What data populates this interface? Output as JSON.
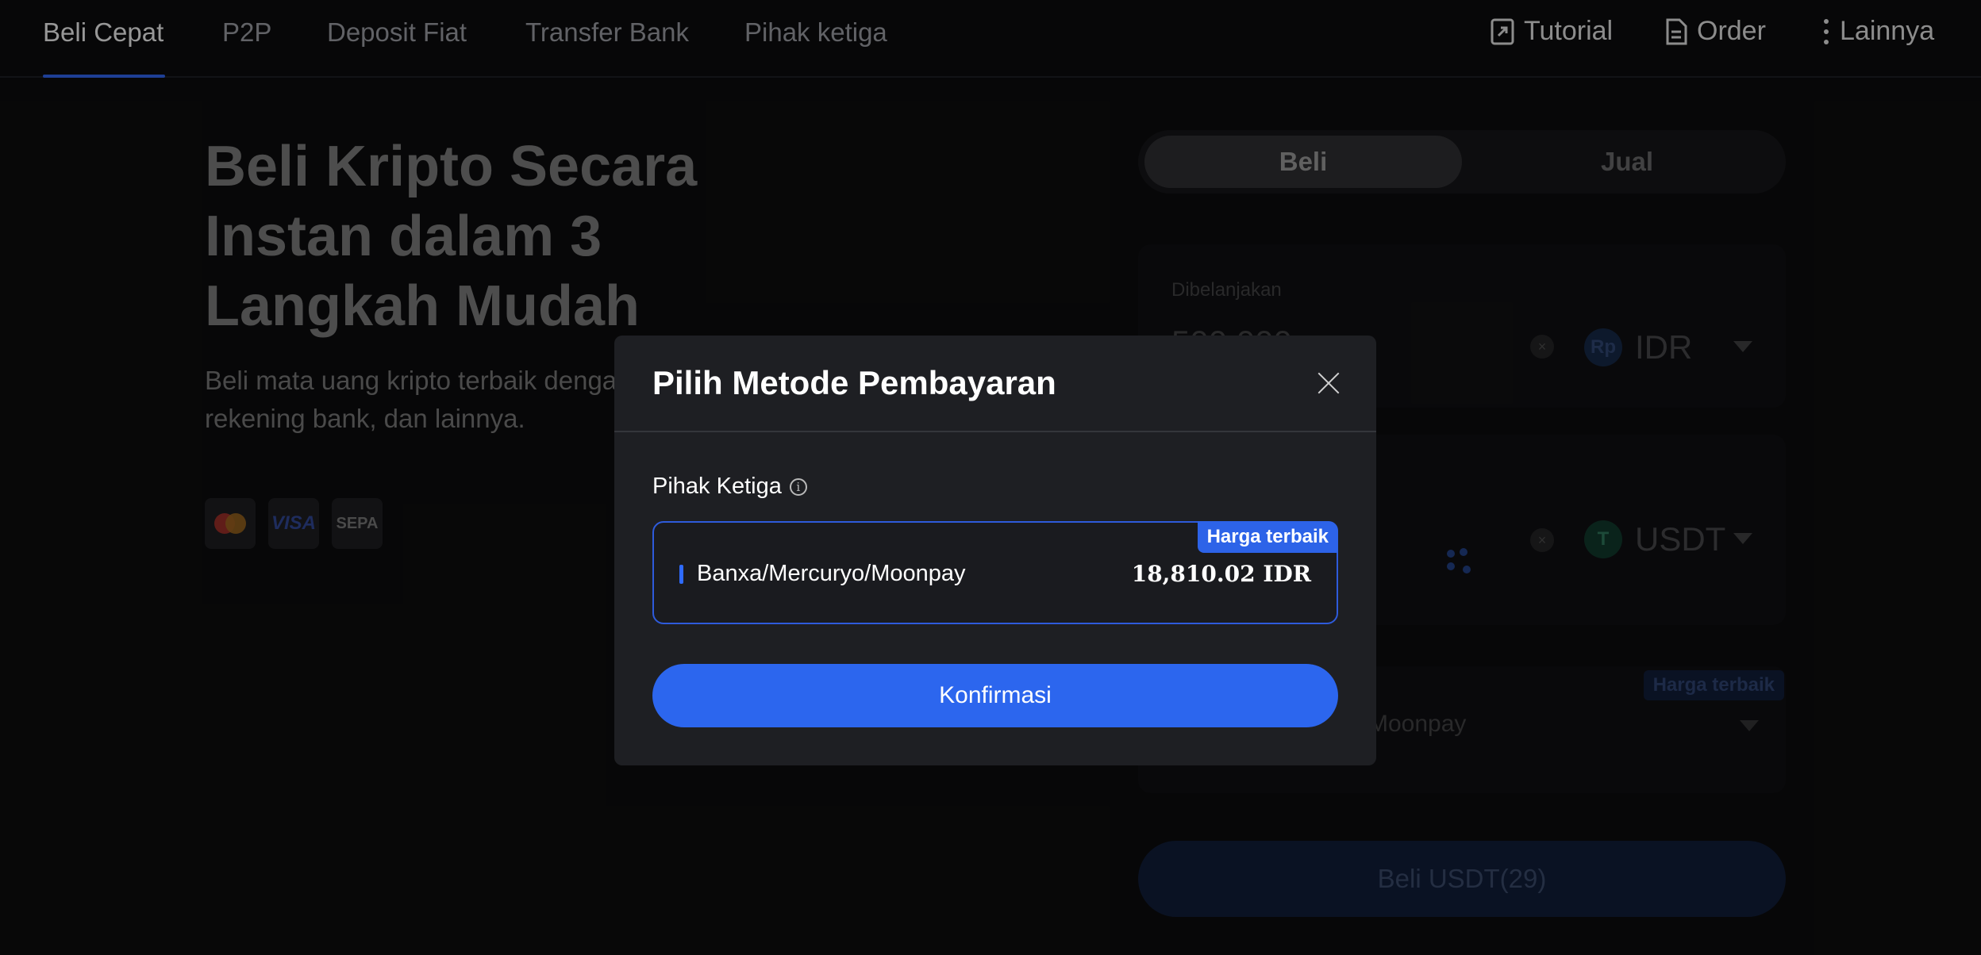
{
  "nav": {
    "tabs": [
      "Beli Cepat",
      "P2P",
      "Deposit Fiat",
      "Transfer Bank",
      "Pihak ketiga"
    ],
    "tutorial": "Tutorial",
    "order": "Order",
    "more": "Lainnya"
  },
  "hero": {
    "title": "Beli Kripto Secara Instan dalam 3 Langkah Mudah",
    "subtitle": "Beli mata uang kripto terbaik dengan rekening bank, dan lainnya.",
    "payment_icons": [
      "mastercard-icon",
      "visa-icon",
      "sepa-icon"
    ],
    "visa": "VISA",
    "sepa": "SEPA"
  },
  "trade": {
    "buy": "Beli",
    "sell": "Jual",
    "spend_label": "Dibelanjakan",
    "spend_amount": "500.000",
    "fiat_symbol": "Rp",
    "fiat": "IDR",
    "crypto_symbol": "T",
    "crypto": "USDT",
    "provider_partial": "Moonpay",
    "best_price": "Harga terbaik",
    "buy_button": "Beli USDT(29)"
  },
  "modal": {
    "title": "Pilih Metode Pembayaran",
    "section": "Pihak Ketiga",
    "info_glyph": "i",
    "option": {
      "badge": "Harga terbaik",
      "name": "Banxa/Mercuryo/Moonpay",
      "price": "18,810.02 IDR"
    },
    "confirm": "Konfirmasi"
  },
  "colors": {
    "accent": "#2c66ee",
    "background": "#0b0b0c",
    "modal": "#1e1f23"
  }
}
